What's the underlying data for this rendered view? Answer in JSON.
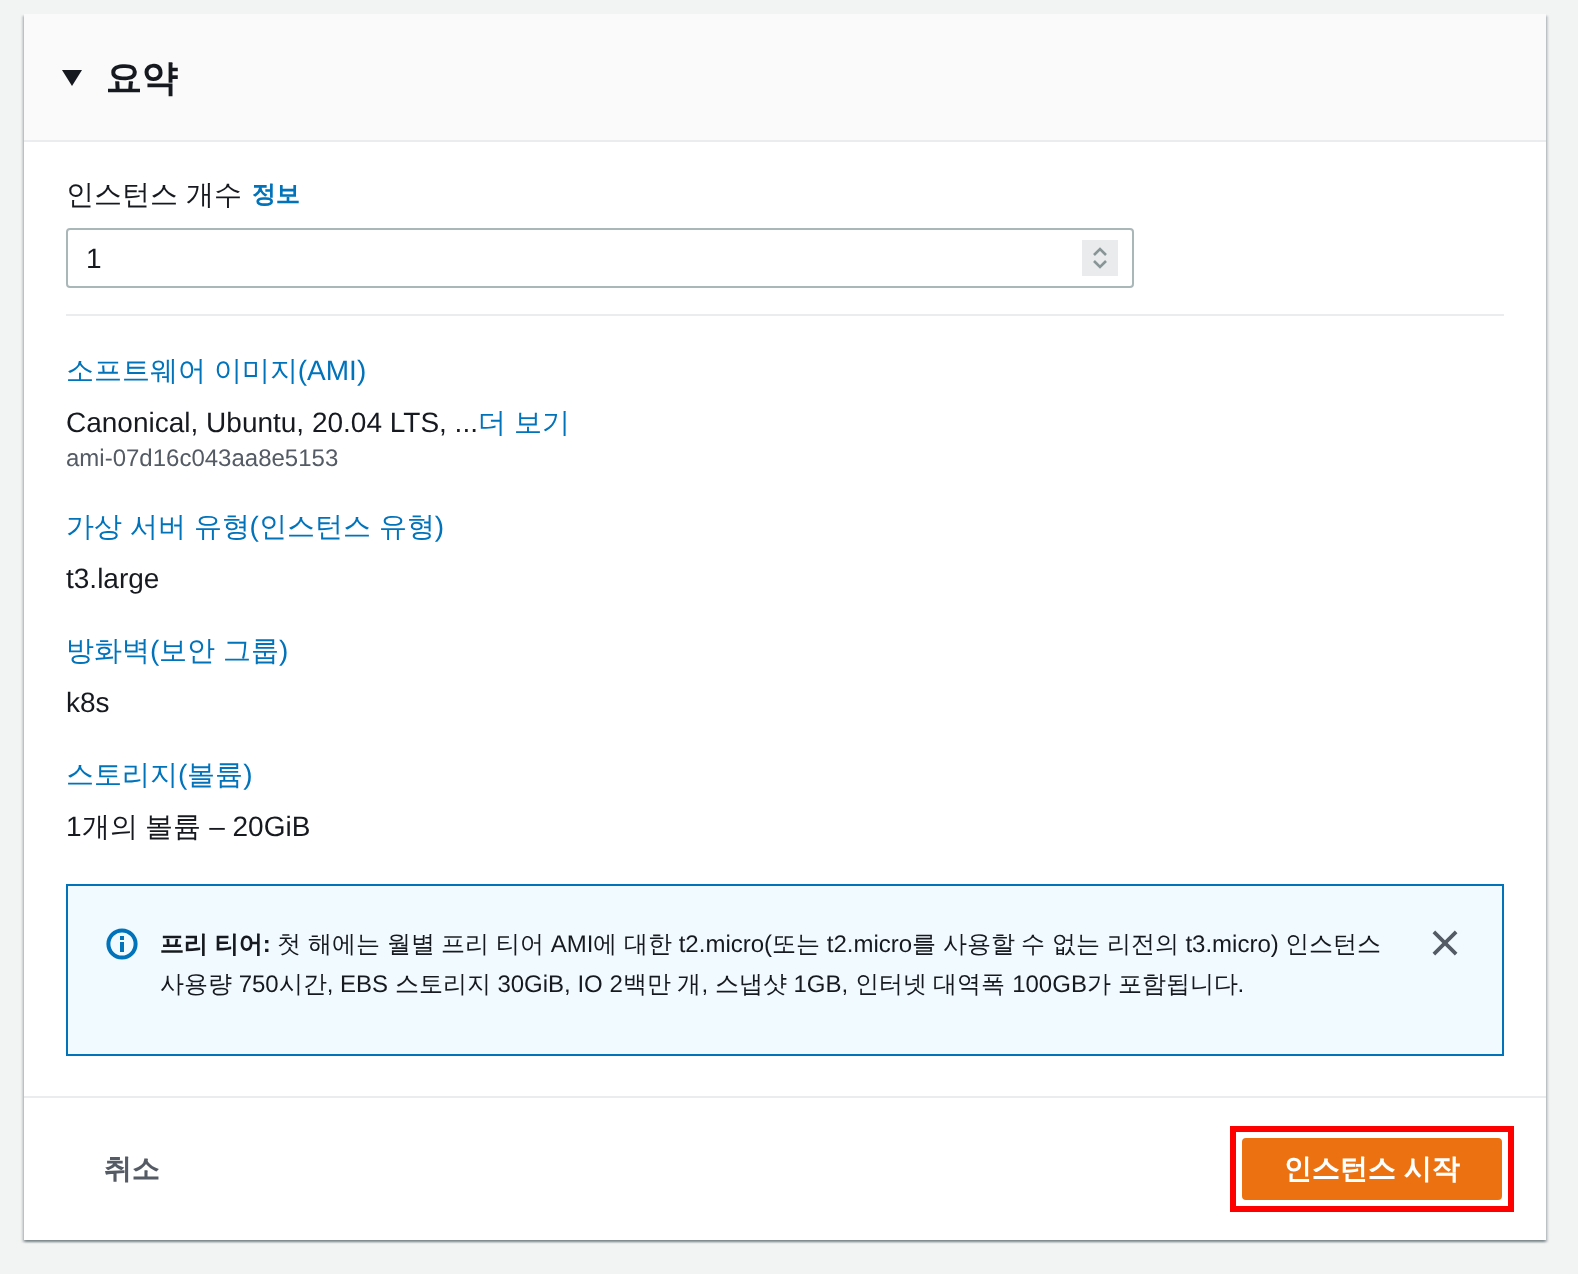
{
  "summary": {
    "title": "요약",
    "expanded": true
  },
  "instance_count": {
    "label": "인스턴스 개수",
    "info_link": "정보",
    "value": "1"
  },
  "details": [
    {
      "label": "소프트웨어 이미지(AMI)",
      "value": "Canonical, Ubuntu, 20.04 LTS, ...",
      "link": "더 보기",
      "sub": "ami-07d16c043aa8e5153"
    },
    {
      "label": "가상 서버 유형(인스턴스 유형)",
      "value": "t3.large"
    },
    {
      "label": "방화벽(보안 그룹)",
      "value": "k8s"
    },
    {
      "label": "스토리지(볼륨)",
      "value": "1개의 볼륨 – 20GiB"
    }
  ],
  "notice": {
    "text": "**프리 티어:** 첫 해에는 월별 프리 티어 AMI에 대한 t2.micro(또는 t2.micro를 사용할 수 없는 리전의 t3.micro) 인스턴스 사용량 750시간, EBS 스토리지 30GiB, IO 2백만 개, 스냅샷 1GB, 인터넷 대역폭 100GB가 포함됩니다."
  },
  "footer": {
    "cancel": "취소",
    "launch": {
      "label": "인스턴스 시작",
      "highlighted": true
    }
  }
}
